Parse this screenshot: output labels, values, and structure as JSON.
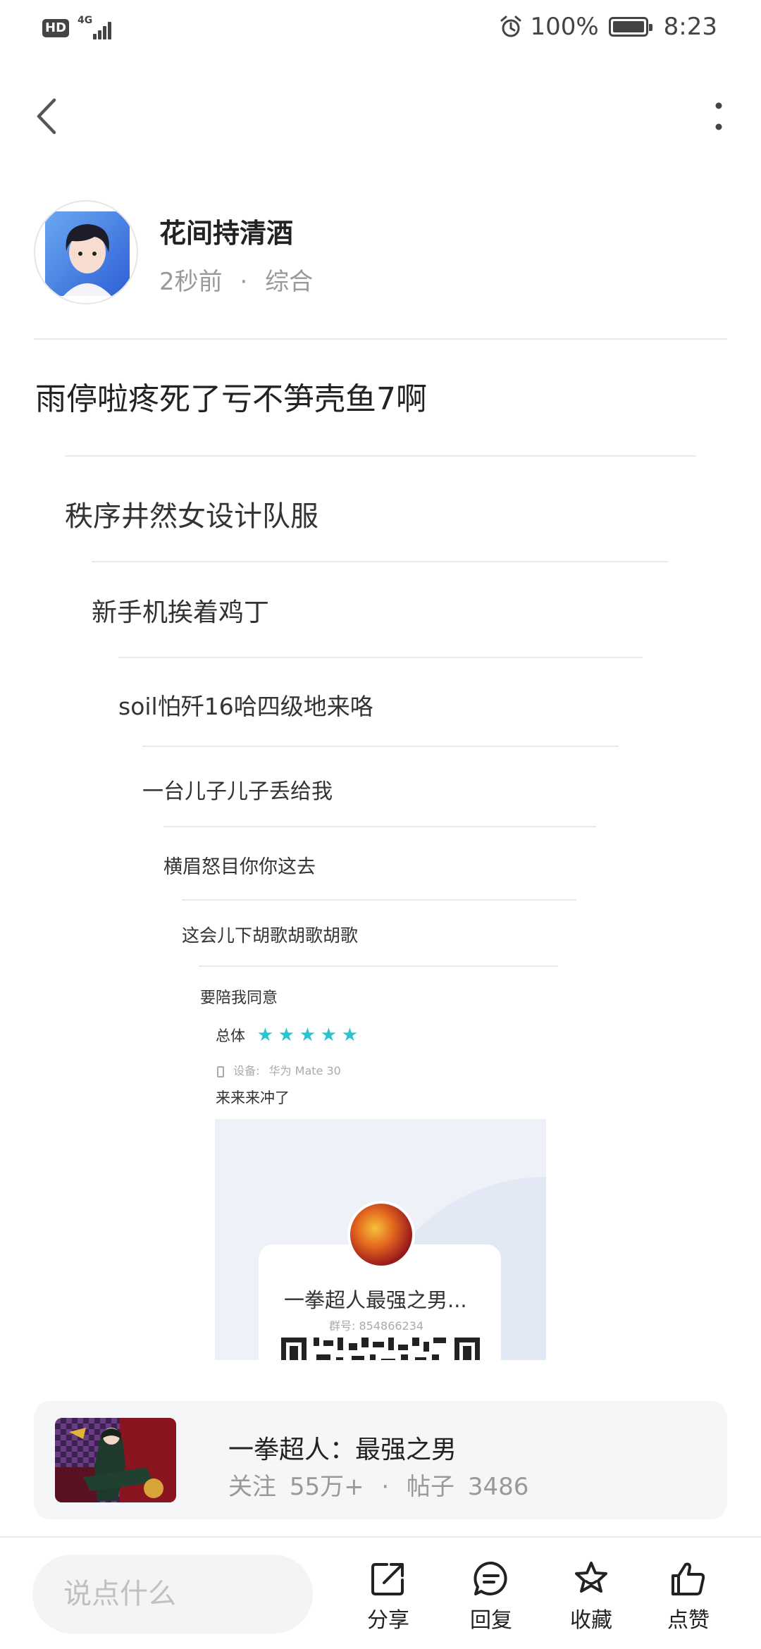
{
  "status_bar": {
    "network_badge": "HD",
    "network_type": "4G",
    "battery_percent": "100%",
    "time": "8:23"
  },
  "nav": {
    "back_icon": "chevron-left-icon",
    "more_icon": "more-vertical-icon"
  },
  "post": {
    "author_name": "花间持清酒",
    "time_ago": "2秒前",
    "meta_separator": "·",
    "category": "综合",
    "title": "雨停啦疼死了亏不笋壳鱼7啊"
  },
  "quoted_thread": {
    "lines": [
      "秩序井然女设计队服",
      "新手机挨着鸡丁",
      "soil怕歼16哈四级地来咯",
      "一台儿子儿子丢给我",
      "横眉怒目你你这去",
      "这会儿下胡歌胡歌胡歌",
      "要陪我同意"
    ],
    "rating_label": "总体",
    "rating_stars": 5,
    "device_label": "设备:",
    "device_value": "华为 Mate 30",
    "comment": "来来来冲了",
    "group_name": "一拳超人最强之男...",
    "group_id": "群号: 854866234"
  },
  "forum": {
    "name": "一拳超人：最强之男",
    "follow_label": "关注",
    "follow_count": "55万+",
    "separator": "·",
    "posts_label": "帖子",
    "posts_count": "3486"
  },
  "bottom_bar": {
    "input_placeholder": "说点什么",
    "share_label": "分享",
    "reply_label": "回复",
    "favorite_label": "收藏",
    "like_label": "点赞"
  },
  "colors": {
    "star": "#29c4cf",
    "text_primary": "#222222",
    "text_secondary": "#999999",
    "card_bg": "#f5f6f8"
  }
}
